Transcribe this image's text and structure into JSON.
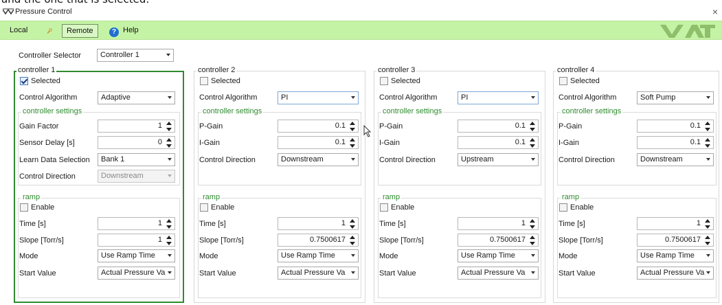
{
  "top_caption": "and the one that is selected:",
  "window": {
    "title": "Pressure Control",
    "close": "×",
    "logo_icon": "vat-app-icon"
  },
  "toolbar": {
    "local": "Local",
    "remote": "Remote",
    "help": "Help",
    "help_glyph": "?",
    "brand": "VAT",
    "accent": "#c5f3a6"
  },
  "selector": {
    "label": "Controller Selector",
    "value": "Controller 1"
  },
  "labels": {
    "selected": "Selected",
    "control_algorithm": "Control Algorithm",
    "controller_settings": "controller settings",
    "gain_factor": "Gain Factor",
    "sensor_delay": "Sensor Delay [s]",
    "learn_data": "Learn Data Selection",
    "control_direction": "Control Direction",
    "p_gain": "P-Gain",
    "i_gain": "I-Gain",
    "ramp": "ramp",
    "enable": "Enable",
    "time": "Time [s]",
    "slope": "Slope [Torr/s]",
    "mode": "Mode",
    "start_value": "Start Value"
  },
  "controllers": [
    {
      "title": "controller 1",
      "selected": true,
      "algorithm": "Adaptive",
      "gain_factor": "1",
      "sensor_delay": "0",
      "learn_data": "Bank 1",
      "direction": "Downstream",
      "ramp_enabled": false,
      "time": "1",
      "slope": "1",
      "mode": "Use Ramp Time",
      "start_value": "Actual Pressure Va"
    },
    {
      "title": "controller 2",
      "selected": false,
      "algorithm": "PI",
      "p_gain": "0.1",
      "i_gain": "0.1",
      "direction": "Downstream",
      "ramp_enabled": false,
      "time": "1",
      "slope": "0.7500617",
      "mode": "Use Ramp Time",
      "start_value": "Actual Pressure Va"
    },
    {
      "title": "controller 3",
      "selected": false,
      "algorithm": "PI",
      "p_gain": "0.1",
      "i_gain": "0.1",
      "direction": "Upstream",
      "ramp_enabled": false,
      "time": "1",
      "slope": "0.7500617",
      "mode": "Use Ramp Time",
      "start_value": "Actual Pressure Va"
    },
    {
      "title": "controller 4",
      "selected": false,
      "algorithm": "Soft Pump",
      "p_gain": "0.1",
      "i_gain": "0.1",
      "direction": "Downstream",
      "ramp_enabled": false,
      "time": "1",
      "slope": "0.7500617",
      "mode": "Use Ramp Time",
      "start_value": "Actual Pressure Va"
    }
  ]
}
